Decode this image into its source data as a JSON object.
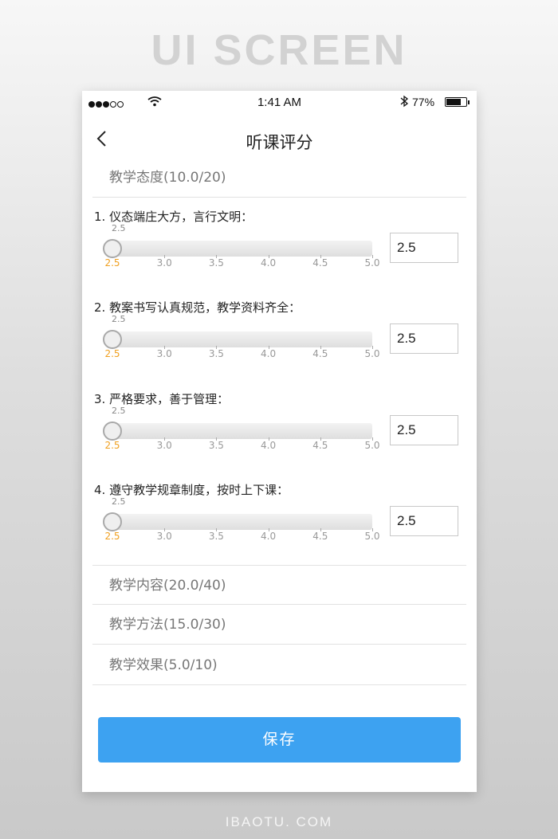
{
  "banner": "UI SCREEN",
  "footer": "IBAOTU. COM",
  "status_bar": {
    "signal_dots": 5,
    "signal_filled": 3,
    "time": "1:41 AM",
    "battery_percent_label": "77%",
    "battery_level": 0.77
  },
  "nav": {
    "title": "听课评分",
    "back_icon": "chevron-left-icon"
  },
  "sections": [
    {
      "title": "教学态度(10.0/20)",
      "expanded": true,
      "items": [
        {
          "question": "1. 仪态端庄大方，言行文明：",
          "current_label": "2.5",
          "value": "2.5"
        },
        {
          "question": "2. 教案书写认真规范，教学资料齐全：",
          "current_label": "2.5",
          "value": "2.5"
        },
        {
          "question": "3. 严格要求，善于管理：",
          "current_label": "2.5",
          "value": "2.5"
        },
        {
          "question": "4. 遵守教学规章制度，按时上下课：",
          "current_label": "2.5",
          "value": "2.5"
        }
      ]
    },
    {
      "title": "教学内容(20.0/40)",
      "expanded": false
    },
    {
      "title": "教学方法(15.0/30)",
      "expanded": false
    },
    {
      "title": "教学效果(5.0/10)",
      "expanded": false
    }
  ],
  "slider": {
    "min": 2.5,
    "max": 5.0,
    "ticks": [
      "2.5",
      "3.0",
      "3.5",
      "4.0",
      "4.5",
      "5.0"
    ],
    "active_color": "#f0a020"
  },
  "save_label": "保存",
  "colors": {
    "primary": "#3da2f1",
    "accent": "#f0a020"
  }
}
